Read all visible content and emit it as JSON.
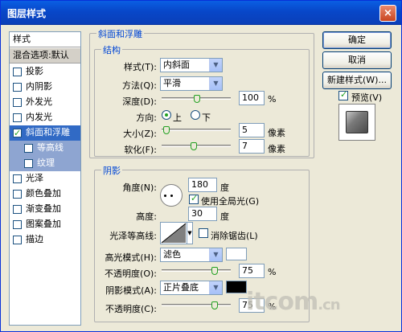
{
  "window": {
    "title": "图层样式",
    "close": "×"
  },
  "styles_list": {
    "header": "样式",
    "blend": "混合选项:默认",
    "items": [
      {
        "label": "投影",
        "checked": false
      },
      {
        "label": "内阴影",
        "checked": false
      },
      {
        "label": "外发光",
        "checked": false
      },
      {
        "label": "内发光",
        "checked": false
      },
      {
        "label": "斜面和浮雕",
        "checked": true
      },
      {
        "label": "等高线",
        "checked": false
      },
      {
        "label": "纹理",
        "checked": false
      },
      {
        "label": "光泽",
        "checked": false
      },
      {
        "label": "颜色叠加",
        "checked": false
      },
      {
        "label": "渐变叠加",
        "checked": false
      },
      {
        "label": "图案叠加",
        "checked": false
      },
      {
        "label": "描边",
        "checked": false
      }
    ]
  },
  "bevel": {
    "group_title": "斜面和浮雕",
    "structure_title": "结构",
    "style_label": "样式(T):",
    "style_value": "内斜面",
    "technique_label": "方法(Q):",
    "technique_value": "平滑",
    "depth_label": "深度(D):",
    "depth_value": "100",
    "depth_unit": "%",
    "direction_label": "方向:",
    "direction_up": "上",
    "direction_down": "下",
    "size_label": "大小(Z):",
    "size_value": "5",
    "size_unit": "像素",
    "soften_label": "软化(F):",
    "soften_value": "7",
    "soften_unit": "像素"
  },
  "shading": {
    "title": "阴影",
    "angle_label": "角度(N):",
    "angle_value": "180",
    "angle_unit": "度",
    "global_light_label": "使用全局光(G)",
    "altitude_label": "高度:",
    "altitude_value": "30",
    "altitude_unit": "度",
    "gloss_label": "光泽等高线:",
    "antialias_label": "消除锯齿(L)",
    "highlight_mode_label": "高光模式(H):",
    "highlight_mode_value": "滤色",
    "highlight_color": "#ffffff",
    "highlight_opacity_label": "不透明度(O):",
    "highlight_opacity_value": "75",
    "highlight_opacity_unit": "%",
    "shadow_mode_label": "阴影模式(A):",
    "shadow_mode_value": "正片叠底",
    "shadow_color": "#000000",
    "shadow_opacity_label": "不透明度(C):",
    "shadow_opacity_value": "75",
    "shadow_opacity_unit": "%"
  },
  "buttons": {
    "ok": "确定",
    "cancel": "取消",
    "new_style": "新建样式(W)...",
    "preview": "预览(V)"
  },
  "watermark": {
    "main": "itcom",
    "tld": ".cn"
  }
}
